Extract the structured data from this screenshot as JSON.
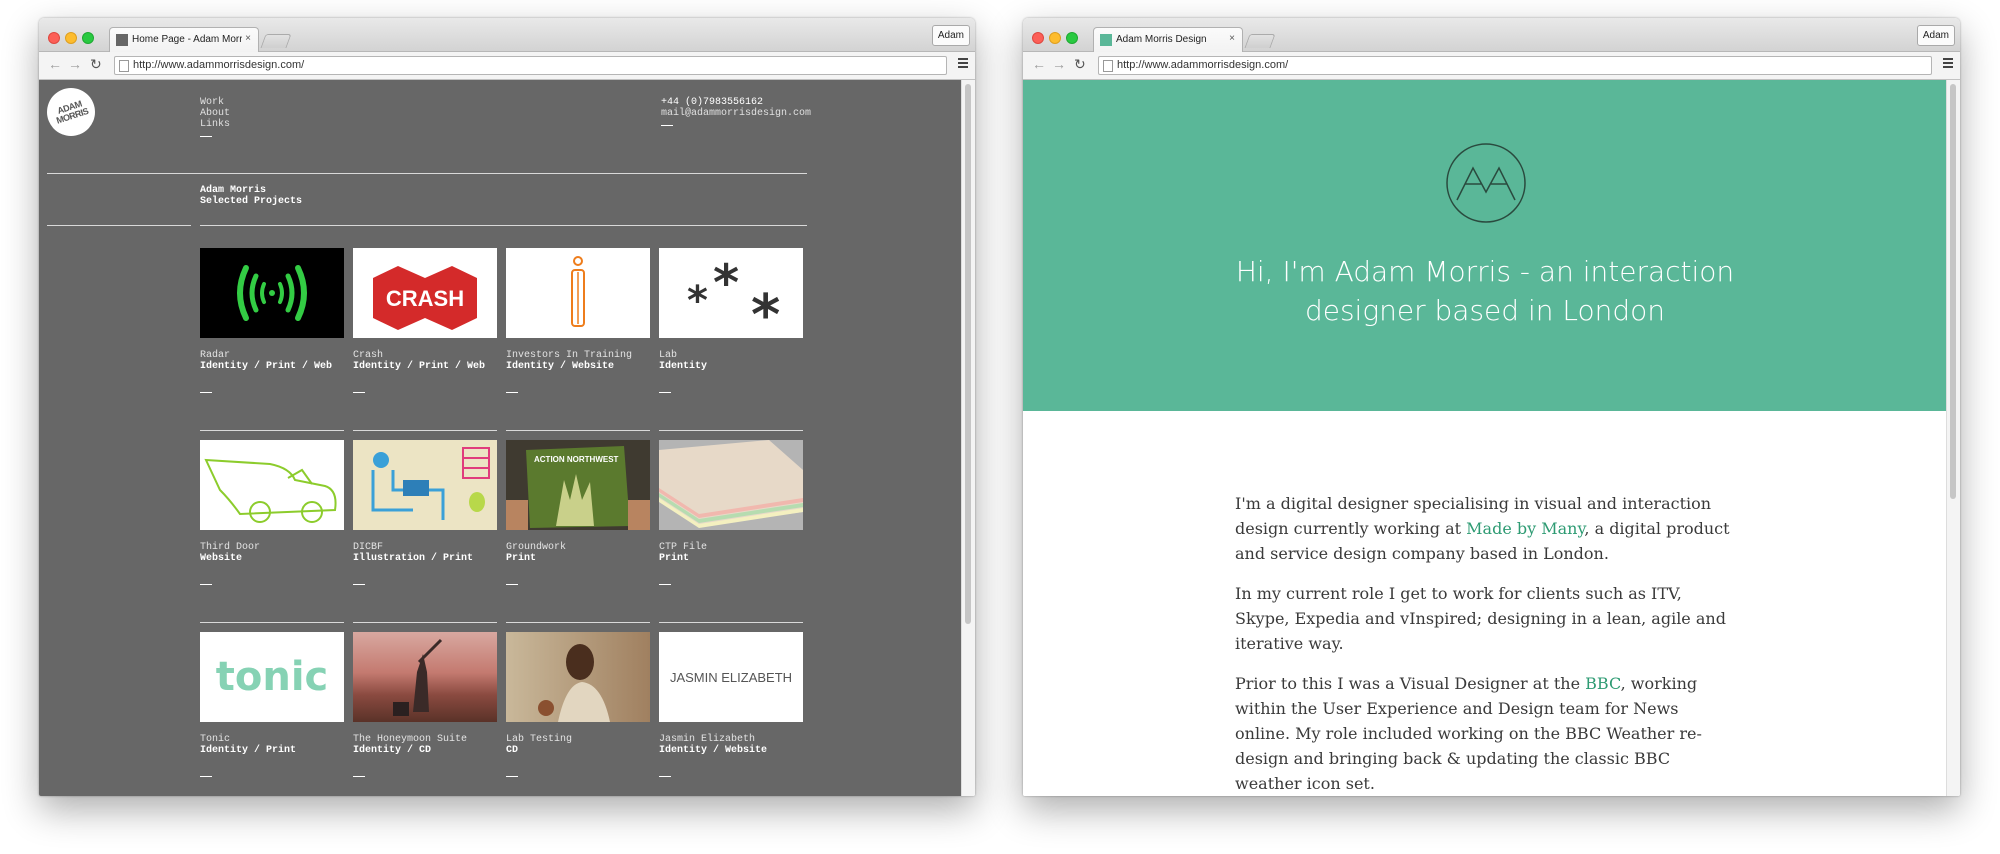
{
  "left_window": {
    "tab_title": "Home Page - Adam Morris",
    "tab_close": "×",
    "profile": "Adam",
    "url": "http://www.adammorrisdesign.com/",
    "site": {
      "logo_text": "ADAM MORRIS",
      "nav": [
        "Work",
        "About",
        "Links"
      ],
      "phone": "+44 (0)7983556162",
      "email": "mail@adammorrisdesign.com",
      "heading_name": "Adam Morris",
      "heading_sub": "Selected Projects",
      "projects": [
        {
          "name": "Radar",
          "tags": "Identity / Print / Web",
          "thumb": "radar-signal"
        },
        {
          "name": "Crash",
          "tags": "Identity / Print / Web",
          "thumb": "crash-logo",
          "thumb_text": "CRASH"
        },
        {
          "name": "Investors In Training",
          "tags": "Identity / Website",
          "thumb": "investors-i"
        },
        {
          "name": "Lab",
          "tags": "Identity",
          "thumb": "lab-stars"
        },
        {
          "name": "Third Door",
          "tags": "Website",
          "thumb": "van-illustration"
        },
        {
          "name": "DICBF",
          "tags": "Illustration / Print",
          "thumb": "map-illustration"
        },
        {
          "name": "Groundwork",
          "tags": "Print",
          "thumb": "action-northwest",
          "thumb_text": "ACTION NORTHWEST"
        },
        {
          "name": "CTP File",
          "tags": "Print",
          "thumb": "paper-stack"
        },
        {
          "name": "Tonic",
          "tags": "Identity / Print",
          "thumb": "tonic-logo",
          "thumb_text": "tonic"
        },
        {
          "name": "The Honeymoon Suite",
          "tags": "Identity / CD",
          "thumb": "desert-photo"
        },
        {
          "name": "Lab Testing",
          "tags": "CD",
          "thumb": "person-photo"
        },
        {
          "name": "Jasmin Elizabeth",
          "tags": "Identity / Website",
          "thumb": "jasmin-logo",
          "thumb_text": "JASMIN ELIZABETH"
        }
      ]
    }
  },
  "right_window": {
    "tab_title": "Adam Morris Design",
    "tab_close": "×",
    "profile": "Adam",
    "url": "http://www.adammorrisdesign.com/",
    "site": {
      "hero_title_line1": "Hi, I'm Adam Morris - an interaction",
      "hero_title_line2": "designer based in London",
      "p1_a": "I'm a digital designer specialising in visual and interaction design currently working at ",
      "p1_link": "Made by Many",
      "p1_b": ", a digital product and service design company based in London.",
      "p2": "In my current role I get to work for clients such as ITV, Skype, Expedia and vInspired; designing in a lean, agile and iterative way.",
      "p3_a": "Prior to this I was a Visual Designer at the ",
      "p3_link": "BBC",
      "p3_b": ", working within the User Experience and Design team for News online. My role included working on the BBC Weather re-design and bringing back & updating the classic BBC weather icon set."
    }
  },
  "colors": {
    "left_site_bg": "#676767",
    "hero_green": "#5ab798",
    "link_green": "#2e9b73"
  },
  "icons": [
    "back-arrow-icon",
    "forward-arrow-icon",
    "reload-icon",
    "page-icon",
    "menu-icon"
  ]
}
